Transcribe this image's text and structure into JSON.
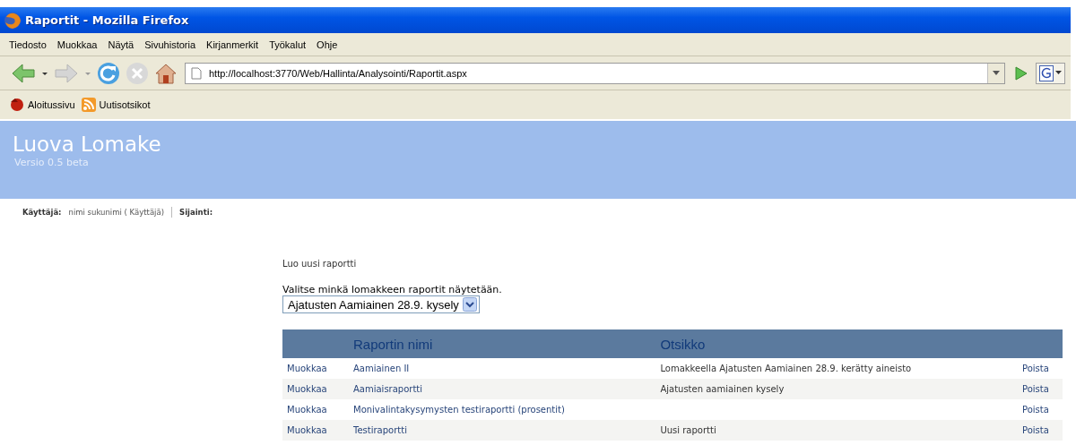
{
  "window": {
    "title": "Raportit - Mozilla Firefox"
  },
  "menu": [
    "Tiedosto",
    "Muokkaa",
    "Näytä",
    "Sivuhistoria",
    "Kirjanmerkit",
    "Työkalut",
    "Ohje"
  ],
  "address": {
    "value": "http://localhost:3770/Web/Hallinta/Analysointi/Raportit.aspx"
  },
  "bookmarks": [
    {
      "label": "Aloitussivu",
      "kind": "home"
    },
    {
      "label": "Uutisotsikot",
      "kind": "feed"
    }
  ],
  "site": {
    "title": "Luova Lomake",
    "version": "Versio 0.5 beta"
  },
  "user_bar": {
    "user_label": "Käyttäjä:",
    "user": "nimi sukunimi ( Käyttäjä)",
    "location_label": "Sijainti:"
  },
  "new_report_link": "Luo uusi raportti",
  "form_select": {
    "label": "Valitse minkä lomakkeen raportit näytetään.",
    "value": "Ajatusten Aamiainen 28.9. kysely"
  },
  "table": {
    "columns": [
      "Raportin nimi",
      "Otsikko"
    ],
    "rows": [
      {
        "edit": "Muokkaa",
        "name": "Aamiainen II",
        "title": "Lomakkeella Ajatusten Aamiainen 28.9. kerätty aineisto",
        "delete": "Poista"
      },
      {
        "edit": "Muokkaa",
        "name": "Aamiaisraportti",
        "title": "Ajatusten aamiainen kysely",
        "delete": "Poista"
      },
      {
        "edit": "Muokkaa",
        "name": "Monivalintakysymysten testiraportti (prosentit)",
        "delete": "Poista"
      },
      {
        "edit": "Muokkaa",
        "name": "Testiraportti",
        "title": "Uusi raportti",
        "delete": "Poista"
      }
    ]
  }
}
